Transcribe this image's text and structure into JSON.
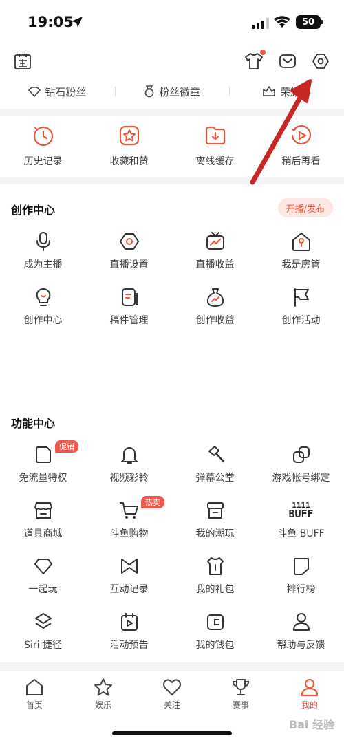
{
  "status": {
    "time": "19:05",
    "battery": "50"
  },
  "fans": [
    {
      "label": "钻石粉丝",
      "icon": "diamond-icon"
    },
    {
      "label": "粉丝徽章",
      "icon": "medal-icon"
    },
    {
      "label": "荣耀爵",
      "icon": "crown-icon"
    }
  ],
  "quick": [
    {
      "label": "历史记录",
      "icon": "history-icon"
    },
    {
      "label": "收藏和赞",
      "icon": "favorites-icon"
    },
    {
      "label": "离线缓存",
      "icon": "download-folder-icon"
    },
    {
      "label": "稍后再看",
      "icon": "play-later-icon"
    }
  ],
  "creation": {
    "title": "创作中心",
    "live_button": "开播/发布",
    "items": [
      {
        "label": "成为主播",
        "icon": "microphone-icon"
      },
      {
        "label": "直播设置",
        "icon": "hexagon-settings-icon"
      },
      {
        "label": "直播收益",
        "icon": "tv-chart-icon"
      },
      {
        "label": "我是房管",
        "icon": "house-key-icon"
      },
      {
        "label": "创作中心",
        "icon": "bulb-icon"
      },
      {
        "label": "稿件管理",
        "icon": "document-icon"
      },
      {
        "label": "创作收益",
        "icon": "money-bag-icon"
      },
      {
        "label": "创作活动",
        "icon": "flag-icon"
      }
    ]
  },
  "functions": {
    "title": "功能中心",
    "items": [
      {
        "label": "免流量特权",
        "icon": "sim-card-icon",
        "badge": "促销"
      },
      {
        "label": "视频彩铃",
        "icon": "bell-icon"
      },
      {
        "label": "弹幕公堂",
        "icon": "hammer-icon"
      },
      {
        "label": "游戏帐号绑定",
        "icon": "link-icon"
      },
      {
        "label": "道具商城",
        "icon": "store-icon"
      },
      {
        "label": "斗鱼购物",
        "icon": "cart-icon",
        "badge": "热卖"
      },
      {
        "label": "我的潮玩",
        "icon": "box-icon"
      },
      {
        "label": "斗鱼 BUFF",
        "icon": "buff-logo-icon",
        "buff_top": "1111",
        "buff_bottom": "BUFF"
      },
      {
        "label": "一起玩",
        "icon": "gem-icon"
      },
      {
        "label": "互动记录",
        "icon": "bowtie-icon"
      },
      {
        "label": "我的礼包",
        "icon": "gift-bag-icon"
      },
      {
        "label": "排行榜",
        "icon": "ranking-icon"
      },
      {
        "label": "Siri 捷径",
        "icon": "layers-icon"
      },
      {
        "label": "活动预告",
        "icon": "calendar-play-icon"
      },
      {
        "label": "我的钱包",
        "icon": "wallet-icon"
      },
      {
        "label": "帮助与反馈",
        "icon": "user-icon"
      }
    ]
  },
  "tabs": [
    {
      "label": "首页",
      "icon": "home-icon"
    },
    {
      "label": "娱乐",
      "icon": "star-icon"
    },
    {
      "label": "关注",
      "icon": "heart-icon"
    },
    {
      "label": "赛事",
      "icon": "trophy-icon"
    },
    {
      "label": "我的",
      "icon": "profile-icon",
      "active": true
    }
  ],
  "watermark": "Bai 经验",
  "colors": {
    "accent": "#e8573a",
    "badge": "#f0564a",
    "arrow": "#c62828"
  }
}
